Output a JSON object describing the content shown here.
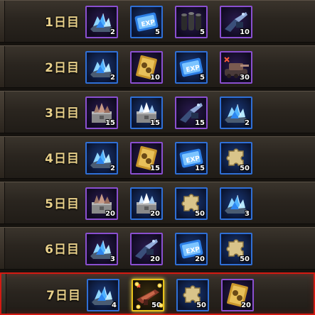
{
  "rows": [
    {
      "day": "1日目",
      "items": [
        {
          "icon": "blue-crystal-icon",
          "frame": "purple",
          "count": "2"
        },
        {
          "icon": "exp-ticket-icon",
          "frame": "blue",
          "count": "5"
        },
        {
          "icon": "black-cylinders-icon",
          "frame": "purple",
          "count": "5"
        },
        {
          "icon": "mech-weapon-icon",
          "frame": "purple",
          "count": "10"
        }
      ]
    },
    {
      "day": "2日目",
      "items": [
        {
          "icon": "blue-crystal-icon",
          "frame": "blue",
          "count": "2"
        },
        {
          "icon": "gold-ticket-icon",
          "frame": "purple",
          "count": "10"
        },
        {
          "icon": "exp-ticket-icon",
          "frame": "blue",
          "count": "5"
        },
        {
          "icon": "mech-tank-icon",
          "frame": "purple",
          "count": "30"
        }
      ]
    },
    {
      "day": "3日目",
      "items": [
        {
          "icon": "ore-box-icon",
          "frame": "purple",
          "count": "15"
        },
        {
          "icon": "crystal-box-icon",
          "frame": "blue",
          "count": "15"
        },
        {
          "icon": "mech-weapon-icon",
          "frame": "purple",
          "count": "15"
        },
        {
          "icon": "blue-crystal-icon",
          "frame": "blue",
          "count": "2"
        }
      ]
    },
    {
      "day": "4日目",
      "items": [
        {
          "icon": "blue-crystal-icon",
          "frame": "blue",
          "count": "2"
        },
        {
          "icon": "gold-ticket-icon",
          "frame": "purple",
          "count": "15"
        },
        {
          "icon": "exp-ticket-icon",
          "frame": "blue",
          "count": "15"
        },
        {
          "icon": "puzzle-piece-icon",
          "frame": "blue",
          "count": "50"
        }
      ]
    },
    {
      "day": "5日目",
      "items": [
        {
          "icon": "ore-box-icon",
          "frame": "purple",
          "count": "20"
        },
        {
          "icon": "crystal-box-icon",
          "frame": "blue",
          "count": "20"
        },
        {
          "icon": "puzzle-piece-icon",
          "frame": "blue",
          "count": "50"
        },
        {
          "icon": "blue-crystal-icon",
          "frame": "blue",
          "count": "3"
        }
      ]
    },
    {
      "day": "6日目",
      "items": [
        {
          "icon": "blue-crystal-icon",
          "frame": "purple",
          "count": "3"
        },
        {
          "icon": "mech-weapon-icon",
          "frame": "purple",
          "count": "20"
        },
        {
          "icon": "exp-ticket-icon",
          "frame": "blue",
          "count": "20"
        },
        {
          "icon": "puzzle-piece-icon",
          "frame": "blue",
          "count": "50"
        }
      ]
    },
    {
      "day": "7日目",
      "items": [
        {
          "icon": "blue-crystal-icon",
          "frame": "blue",
          "count": "4"
        },
        {
          "icon": "mech-gun-icon",
          "frame": "gold",
          "count": "50"
        },
        {
          "icon": "puzzle-piece-icon",
          "frame": "blue",
          "count": "50"
        },
        {
          "icon": "gold-ticket-icon",
          "frame": "purple",
          "count": "20"
        }
      ]
    }
  ],
  "highlighted_day": "7日目",
  "colors": {
    "day_text": "#e8d08a",
    "highlight_border": "#d41a12",
    "frame_blue": "#2f6fd6",
    "frame_purple": "#8a4fd0",
    "frame_gold": "#e6c21a"
  }
}
